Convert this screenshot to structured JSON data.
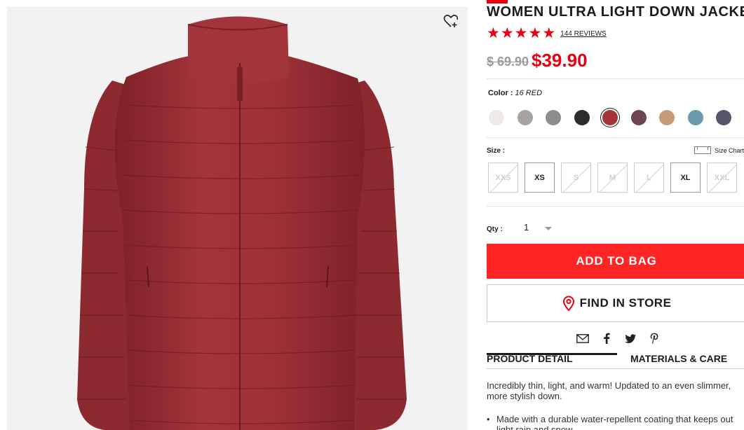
{
  "product": {
    "title": "WOMEN ULTRA LIGHT DOWN JACKET",
    "rating_stars": 5,
    "reviews": "144 REVIEWS",
    "old_price": "$ 69.90",
    "new_price": "$39.90"
  },
  "color": {
    "label": "Color :",
    "selected": "16 RED",
    "swatches": [
      {
        "hex": "#eeebe7",
        "selected": false
      },
      {
        "hex": "#a8a3a1",
        "selected": false
      },
      {
        "hex": "#8e8c8c",
        "selected": false
      },
      {
        "hex": "#2c2c2c",
        "selected": false
      },
      {
        "hex": "#a4333b",
        "selected": true
      },
      {
        "hex": "#6e4550",
        "selected": false
      },
      {
        "hex": "#c79a76",
        "selected": false
      },
      {
        "hex": "#6b98aa",
        "selected": false
      },
      {
        "hex": "#545769",
        "selected": false
      }
    ]
  },
  "size": {
    "label": "Size :",
    "chart_label": "Size Chart",
    "options": [
      {
        "label": "XXS",
        "available": false
      },
      {
        "label": "XS",
        "available": true
      },
      {
        "label": "S",
        "available": false
      },
      {
        "label": "M",
        "available": false
      },
      {
        "label": "L",
        "available": false
      },
      {
        "label": "XL",
        "available": true
      },
      {
        "label": "XXL",
        "available": false
      }
    ]
  },
  "qty": {
    "label": "Qty :",
    "value": "1"
  },
  "actions": {
    "add_to_bag": "ADD TO BAG",
    "find_in_store": "FIND IN STORE"
  },
  "tabs": {
    "product_detail": "PRODUCT DETAIL",
    "materials": "MATERIALS & CARE"
  },
  "detail": {
    "description": "Incredibly thin, light, and warm! Updated to an even slimmer, more stylish down.",
    "bullet_1": "Made with a durable water-repellent coating that keeps out light rain and snow."
  },
  "colors": {
    "brand_red": "#e60012",
    "button_red": "#ff2525",
    "jacket": "#9b2f35"
  },
  "icons": [
    "wishlist-heart-icon",
    "star-icon",
    "ruler-icon",
    "location-pin-icon",
    "mail-icon",
    "facebook-icon",
    "twitter-icon",
    "pinterest-icon",
    "chevron-down-icon"
  ]
}
